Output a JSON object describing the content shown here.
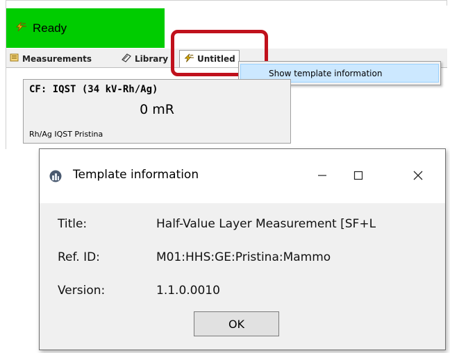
{
  "status": {
    "label": "Ready",
    "color": "#00cc00"
  },
  "tabs": [
    {
      "label": "Measurements",
      "icon": "measurements-icon"
    },
    {
      "label": "Library",
      "icon": "library-icon"
    },
    {
      "label": "Untitled",
      "icon": "template-bolt-icon",
      "active": true
    }
  ],
  "context_menu": {
    "items": [
      {
        "label": "Show template information",
        "highlighted": true
      }
    ]
  },
  "measurement_card": {
    "title": "CF: IQST (34 kV-Rh/Ag)",
    "value": "0 mR",
    "subtitle": "Rh/Ag IQST Pristina"
  },
  "dialog": {
    "title": "Template information",
    "fields": [
      {
        "label": "Title:",
        "value": "Half-Value Layer Measurement [SF+L"
      },
      {
        "label": "Ref. ID:",
        "value": "M01:HHS:GE:Pristina:Mammo"
      },
      {
        "label": "Version:",
        "value": "1.1.0.0010"
      }
    ],
    "ok_label": "OK"
  },
  "colors": {
    "highlight_outline": "#c0111c",
    "menu_selection": "#cce8ff"
  }
}
